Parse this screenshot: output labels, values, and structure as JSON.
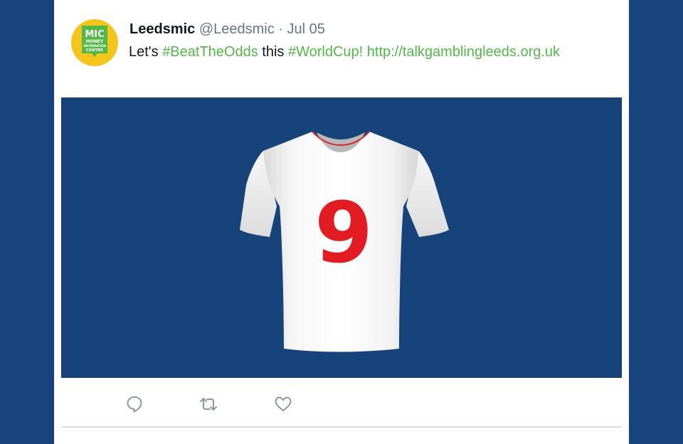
{
  "tweet": {
    "display_name": "Leedsmic",
    "handle": "@Leedsmic",
    "separator": "·",
    "date": "Jul 05",
    "text_before": "Let's ",
    "hashtag_1": "#BeatTheOdds",
    "text_middle": " this ",
    "hashtag_2": "#WorldCup!",
    "text_space": " ",
    "link": "http://talkgamblingleeds.org.uk"
  },
  "avatar": {
    "logo_lines": [
      "MIC",
      "MONEY",
      "INFORMATION",
      "CENTRE"
    ],
    "colors": {
      "background": "#f5c51b",
      "badge": "#52b846",
      "text": "#ffffff"
    }
  },
  "media": {
    "shirt_number": "9",
    "colors": {
      "background": "#17437b",
      "shirt": "#f4f4f4",
      "number": "#e31b23",
      "collar_trim": "#d72330"
    }
  },
  "actions": [
    {
      "name": "reply",
      "icon": "reply-icon"
    },
    {
      "name": "retweet",
      "icon": "retweet-icon"
    },
    {
      "name": "like",
      "icon": "heart-icon"
    }
  ],
  "colors": {
    "page_background": "#17447c",
    "link": "#52b846",
    "muted_text": "#657786",
    "primary_text": "#14171a",
    "icon": "#8b98a5"
  }
}
